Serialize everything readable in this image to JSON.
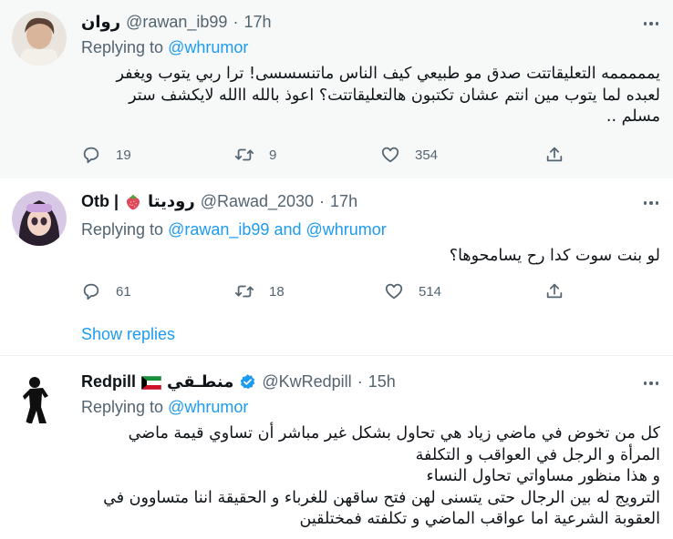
{
  "tweets": [
    {
      "name": "روان",
      "handle": "@rawan_ib99",
      "dot": "·",
      "time": "17h",
      "replying_prefix": "Replying to",
      "mention1": "@whrumor",
      "lines": [
        "يمممممه التعليقاتتت صدق مو طبيعي كيف الناس ماتنسسسى! ترا ربي يتوب ويغفر",
        "لعبده لما يتوب مين انتم عشان تكتبون هالتعليقاتتت؟ اعوذ بالله االله لايكشف ستر",
        "مسلم .."
      ],
      "replies": "19",
      "retweets": "9",
      "likes": "354"
    },
    {
      "name_prefix": "Otb |",
      "name_suffix": "روديتا",
      "handle": "@Rawad_2030",
      "dot": "·",
      "time": "17h",
      "replying_prefix": "Replying to",
      "mention1": "@rawan_ib99",
      "and": "and",
      "mention2": "@whrumor",
      "lines": [
        "لو بنت سوت كدا رح يسامحوها؟"
      ],
      "replies": "61",
      "retweets": "18",
      "likes": "514",
      "show_replies": "Show replies"
    },
    {
      "name_prefix": "Redpill",
      "name_suffix": "منطـقي",
      "handle": "@KwRedpill",
      "dot": "·",
      "time": "15h",
      "replying_prefix": "Replying to",
      "mention1": "@whrumor",
      "lines": [
        "كل من تخوض  في ماضي زياد هي تحاول بشكل غير مباشر أن تساوي  قيمة ماضي",
        "المرأة و الرجل في العواقب و التكلفة",
        "و هذا منظور مساواتي تحاول النساء",
        "الترويج له بين الرجال حتى يتسنى لهن فتح ساقهن للغرباء و الحقيقة اننا متساوون في",
        "العقوبة الشرعية اما عواقب الماضي و تكلفته فمختلقين"
      ]
    }
  ],
  "colors": {
    "accent": "#1d9bf0",
    "muted": "#536471",
    "shaded_bg": "#f7f9f9",
    "verified": "#1d9bf0"
  }
}
